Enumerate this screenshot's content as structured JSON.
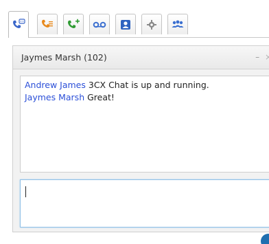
{
  "tabs": [
    {
      "icon": "phone-chat-icon",
      "active": true,
      "color": "#3a66c9"
    },
    {
      "icon": "phone-list-icon",
      "active": false,
      "color": "#e8891b"
    },
    {
      "icon": "phone-add-icon",
      "active": false,
      "color": "#2f9b33"
    },
    {
      "icon": "voicemail-icon",
      "active": false,
      "color": "#3b6fd0"
    },
    {
      "icon": "contacts-icon",
      "active": false,
      "color": "#2f63c0"
    },
    {
      "icon": "gear-icon",
      "active": false,
      "color": "#8a8a8a"
    },
    {
      "icon": "conference-icon",
      "active": false,
      "color": "#3a6fd0"
    }
  ],
  "chat": {
    "title": "Jaymes Marsh (102)",
    "minimize_label": "–",
    "close_label": "×",
    "messages": [
      {
        "sender": "Andrew James",
        "text": " 3CX Chat is up and running."
      },
      {
        "sender": "Jaymes Marsh",
        "text": " Great!"
      }
    ],
    "compose_value": ""
  },
  "colors": {
    "sender": "#2b4fd8",
    "compose_border": "#8fbfe6"
  }
}
